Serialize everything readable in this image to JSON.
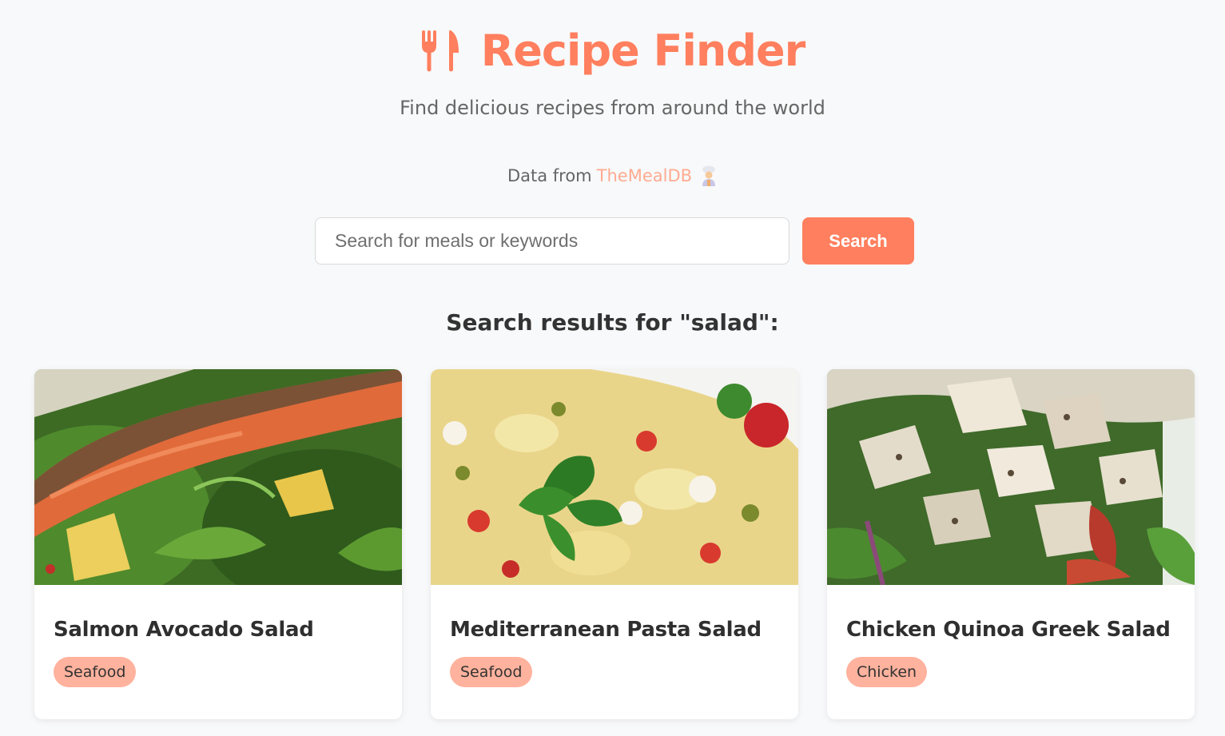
{
  "app": {
    "title": "Recipe Finder",
    "subtitle": "Find delicious recipes from around the world",
    "credit_prefix": "Data from",
    "credit_link": "TheMealDB",
    "logo_icon": "fork-knife-icon",
    "credit_icon": "chef-emoji-icon",
    "accent_color": "#ff7f5e"
  },
  "search": {
    "placeholder": "Search for meals or keywords",
    "value": "",
    "button_label": "Search"
  },
  "results": {
    "heading": "Search results for \"salad\":",
    "items": [
      {
        "title": "Salmon Avocado Salad",
        "category": "Seafood",
        "image": "salmon-avocado-salad-photo"
      },
      {
        "title": "Mediterranean Pasta Salad",
        "category": "Seafood",
        "image": "mediterranean-pasta-salad-photo"
      },
      {
        "title": "Chicken Quinoa Greek Salad",
        "category": "Chicken",
        "image": "chicken-quinoa-greek-salad-photo"
      }
    ]
  }
}
